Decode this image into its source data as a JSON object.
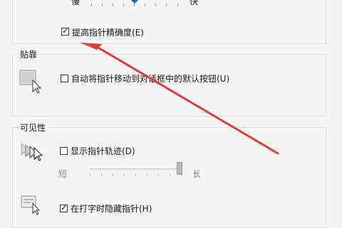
{
  "speed": {
    "slow_label": "慢",
    "fast_label": "快",
    "enhance_precision": {
      "label": "提高指针精确度(E)",
      "checked": true
    }
  },
  "snap_to": {
    "title": "贴靠",
    "default_button": {
      "label": "自动将指针移动到对话框中的默认按钮(U)",
      "checked": false
    }
  },
  "visibility": {
    "title": "可见性",
    "pointer_trails": {
      "label": "显示指针轨迹(D)",
      "checked": false
    },
    "trail_short_label": "短",
    "trail_long_label": "长",
    "hide_while_typing": {
      "label": "在打字时隐藏指针(H)",
      "checked": true
    }
  },
  "annotation": {
    "arrow_color": "#e03c3c"
  }
}
